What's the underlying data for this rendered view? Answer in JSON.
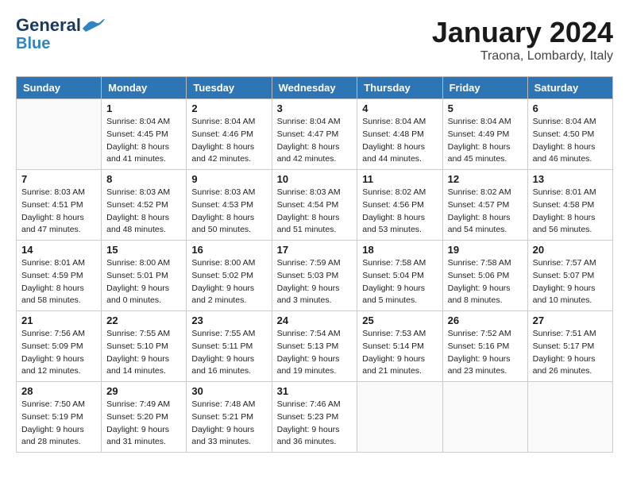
{
  "header": {
    "logo_general": "General",
    "logo_blue": "Blue",
    "month_title": "January 2024",
    "location": "Traona, Lombardy, Italy"
  },
  "days_of_week": [
    "Sunday",
    "Monday",
    "Tuesday",
    "Wednesday",
    "Thursday",
    "Friday",
    "Saturday"
  ],
  "weeks": [
    [
      {
        "day": "",
        "info": ""
      },
      {
        "day": "1",
        "info": "Sunrise: 8:04 AM\nSunset: 4:45 PM\nDaylight: 8 hours\nand 41 minutes."
      },
      {
        "day": "2",
        "info": "Sunrise: 8:04 AM\nSunset: 4:46 PM\nDaylight: 8 hours\nand 42 minutes."
      },
      {
        "day": "3",
        "info": "Sunrise: 8:04 AM\nSunset: 4:47 PM\nDaylight: 8 hours\nand 42 minutes."
      },
      {
        "day": "4",
        "info": "Sunrise: 8:04 AM\nSunset: 4:48 PM\nDaylight: 8 hours\nand 44 minutes."
      },
      {
        "day": "5",
        "info": "Sunrise: 8:04 AM\nSunset: 4:49 PM\nDaylight: 8 hours\nand 45 minutes."
      },
      {
        "day": "6",
        "info": "Sunrise: 8:04 AM\nSunset: 4:50 PM\nDaylight: 8 hours\nand 46 minutes."
      }
    ],
    [
      {
        "day": "7",
        "info": "Sunrise: 8:03 AM\nSunset: 4:51 PM\nDaylight: 8 hours\nand 47 minutes."
      },
      {
        "day": "8",
        "info": "Sunrise: 8:03 AM\nSunset: 4:52 PM\nDaylight: 8 hours\nand 48 minutes."
      },
      {
        "day": "9",
        "info": "Sunrise: 8:03 AM\nSunset: 4:53 PM\nDaylight: 8 hours\nand 50 minutes."
      },
      {
        "day": "10",
        "info": "Sunrise: 8:03 AM\nSunset: 4:54 PM\nDaylight: 8 hours\nand 51 minutes."
      },
      {
        "day": "11",
        "info": "Sunrise: 8:02 AM\nSunset: 4:56 PM\nDaylight: 8 hours\nand 53 minutes."
      },
      {
        "day": "12",
        "info": "Sunrise: 8:02 AM\nSunset: 4:57 PM\nDaylight: 8 hours\nand 54 minutes."
      },
      {
        "day": "13",
        "info": "Sunrise: 8:01 AM\nSunset: 4:58 PM\nDaylight: 8 hours\nand 56 minutes."
      }
    ],
    [
      {
        "day": "14",
        "info": "Sunrise: 8:01 AM\nSunset: 4:59 PM\nDaylight: 8 hours\nand 58 minutes."
      },
      {
        "day": "15",
        "info": "Sunrise: 8:00 AM\nSunset: 5:01 PM\nDaylight: 9 hours\nand 0 minutes."
      },
      {
        "day": "16",
        "info": "Sunrise: 8:00 AM\nSunset: 5:02 PM\nDaylight: 9 hours\nand 2 minutes."
      },
      {
        "day": "17",
        "info": "Sunrise: 7:59 AM\nSunset: 5:03 PM\nDaylight: 9 hours\nand 3 minutes."
      },
      {
        "day": "18",
        "info": "Sunrise: 7:58 AM\nSunset: 5:04 PM\nDaylight: 9 hours\nand 5 minutes."
      },
      {
        "day": "19",
        "info": "Sunrise: 7:58 AM\nSunset: 5:06 PM\nDaylight: 9 hours\nand 8 minutes."
      },
      {
        "day": "20",
        "info": "Sunrise: 7:57 AM\nSunset: 5:07 PM\nDaylight: 9 hours\nand 10 minutes."
      }
    ],
    [
      {
        "day": "21",
        "info": "Sunrise: 7:56 AM\nSunset: 5:09 PM\nDaylight: 9 hours\nand 12 minutes."
      },
      {
        "day": "22",
        "info": "Sunrise: 7:55 AM\nSunset: 5:10 PM\nDaylight: 9 hours\nand 14 minutes."
      },
      {
        "day": "23",
        "info": "Sunrise: 7:55 AM\nSunset: 5:11 PM\nDaylight: 9 hours\nand 16 minutes."
      },
      {
        "day": "24",
        "info": "Sunrise: 7:54 AM\nSunset: 5:13 PM\nDaylight: 9 hours\nand 19 minutes."
      },
      {
        "day": "25",
        "info": "Sunrise: 7:53 AM\nSunset: 5:14 PM\nDaylight: 9 hours\nand 21 minutes."
      },
      {
        "day": "26",
        "info": "Sunrise: 7:52 AM\nSunset: 5:16 PM\nDaylight: 9 hours\nand 23 minutes."
      },
      {
        "day": "27",
        "info": "Sunrise: 7:51 AM\nSunset: 5:17 PM\nDaylight: 9 hours\nand 26 minutes."
      }
    ],
    [
      {
        "day": "28",
        "info": "Sunrise: 7:50 AM\nSunset: 5:19 PM\nDaylight: 9 hours\nand 28 minutes."
      },
      {
        "day": "29",
        "info": "Sunrise: 7:49 AM\nSunset: 5:20 PM\nDaylight: 9 hours\nand 31 minutes."
      },
      {
        "day": "30",
        "info": "Sunrise: 7:48 AM\nSunset: 5:21 PM\nDaylight: 9 hours\nand 33 minutes."
      },
      {
        "day": "31",
        "info": "Sunrise: 7:46 AM\nSunset: 5:23 PM\nDaylight: 9 hours\nand 36 minutes."
      },
      {
        "day": "",
        "info": ""
      },
      {
        "day": "",
        "info": ""
      },
      {
        "day": "",
        "info": ""
      }
    ]
  ]
}
